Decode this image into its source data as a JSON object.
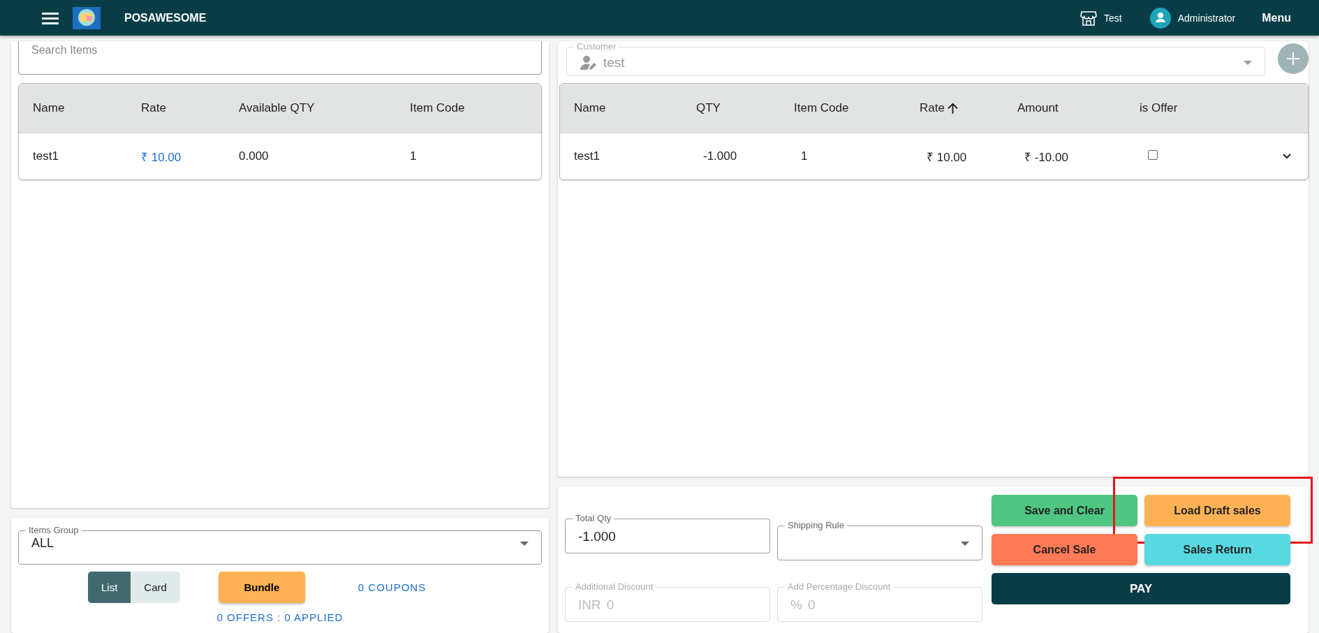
{
  "app_bar": {
    "title": "POSAWESOME",
    "store": "Test",
    "user": "Administrator",
    "menu": "Menu"
  },
  "item_search": {
    "placeholder": "Search Items"
  },
  "items_table": {
    "columns": [
      "Name",
      "Rate",
      "Available QTY",
      "Item Code"
    ],
    "rows": [
      {
        "name": "test1",
        "rate": "₹ 10.00",
        "available_qty": "0.000",
        "item_code": "1"
      }
    ]
  },
  "items_group": {
    "label": "Items Group",
    "value": "ALL"
  },
  "view_toggle": [
    {
      "label": "List",
      "selected": true
    },
    {
      "label": "Card",
      "selected": false
    }
  ],
  "bundle_button": "Bundle",
  "coupons": "0 COUPONS",
  "offers": "0 OFFERS : 0 APPLIED",
  "customer": {
    "label": "Customer",
    "value": "test"
  },
  "cart_table": {
    "columns": [
      {
        "label": "Name",
        "sorted": false
      },
      {
        "label": "QTY",
        "sorted": false
      },
      {
        "label": "Item Code",
        "sorted": false
      },
      {
        "label": "Rate",
        "sorted": true
      },
      {
        "label": "Amount",
        "sorted": false
      },
      {
        "label": "is Offer",
        "sorted": false
      }
    ],
    "rows": [
      {
        "name": "test1",
        "qty": "-1.000",
        "item_code": "1",
        "rate": "₹ 10.00",
        "amount": "₹ -10.00",
        "is_offer": false,
        "expanded": false
      }
    ]
  },
  "totals": {
    "total_qty": {
      "label": "Total Qty",
      "value": "-1.000"
    },
    "shipping_rule": {
      "label": "Shipping Rule"
    },
    "additional_discount": {
      "label": "Additional Discount",
      "prefix": "INR",
      "value": "0",
      "disabled": true
    },
    "percentage_discount": {
      "label": "Add Percentage Discount",
      "prefix": "%",
      "value": "0",
      "disabled": true
    }
  },
  "actions": [
    {
      "label": "Save and Clear",
      "color": "#4fc681",
      "highlighted": false
    },
    {
      "label": "Load Draft sales",
      "color": "#ffb255",
      "highlighted": true
    },
    {
      "label": "Cancel Sale",
      "color": "#ff7a55",
      "highlighted": false
    },
    {
      "label": "Sales Return",
      "color": "#58d9e1",
      "highlighted": false
    }
  ],
  "pay_button": "PAY"
}
